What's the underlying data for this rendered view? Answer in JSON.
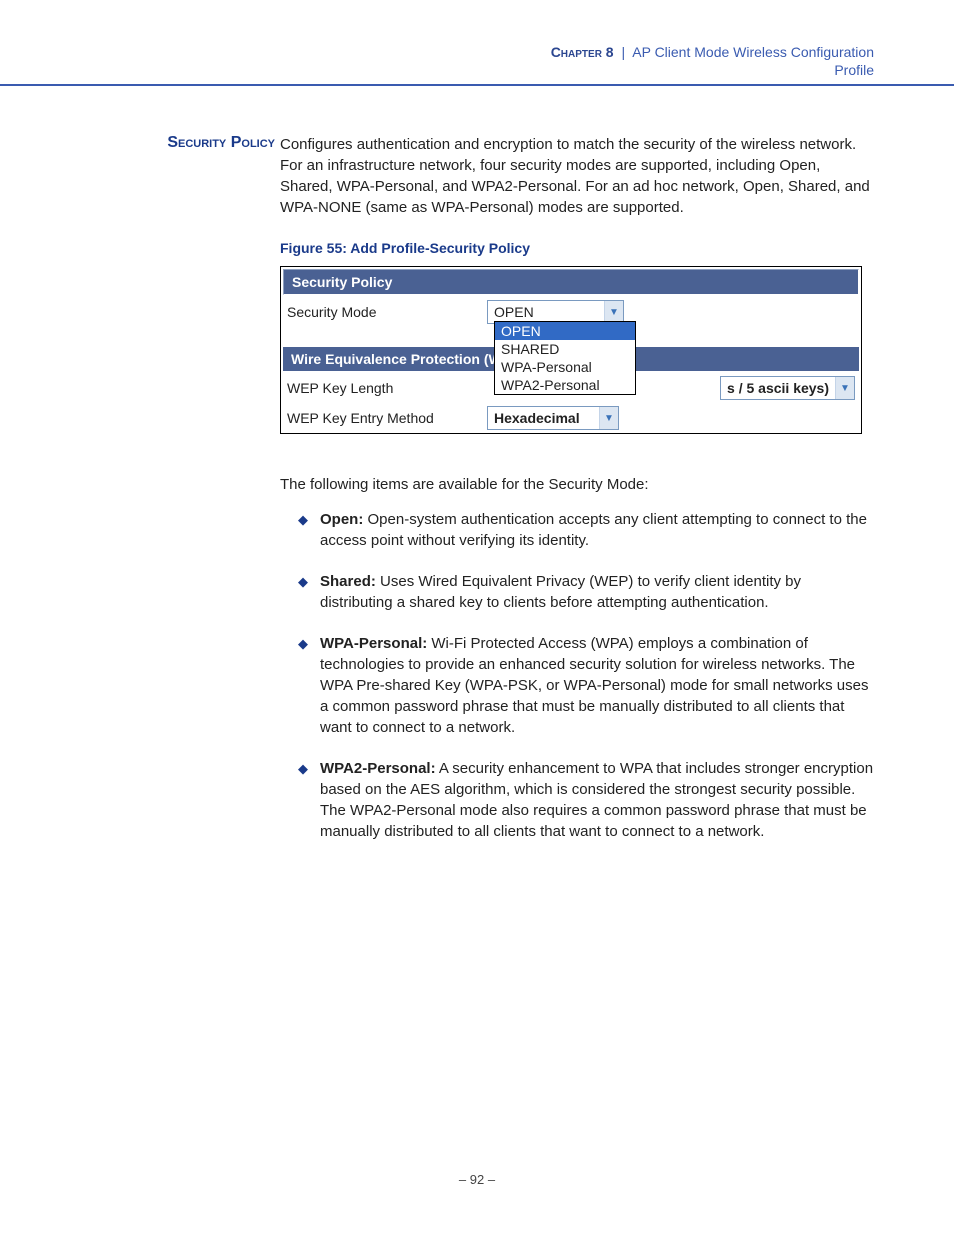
{
  "header": {
    "chapter_label": "Chapter 8",
    "divider": "|",
    "chapter_title": "AP Client Mode Wireless Configuration",
    "subtitle": "Profile"
  },
  "section_heading": "Security Policy",
  "intro_para": "Configures authentication and encryption to match the security of the wireless network. For an infrastructure network, four security modes are supported, including Open, Shared, WPA-Personal, and WPA2-Personal. For an ad hoc network, Open, Shared, and WPA-NONE (same as WPA-Personal) modes are supported.",
  "figure_caption": "Figure 55:  Add Profile-Security Policy",
  "figure": {
    "title": "Security Policy",
    "security_mode_label": "Security Mode",
    "security_mode_value": "OPEN",
    "options": [
      "OPEN",
      "SHARED",
      "WPA-Personal",
      "WPA2-Personal"
    ],
    "wep_section_label": "Wire Equivalence Protection (W",
    "wep_key_length_label": "WEP Key Length",
    "wep_key_length_partial": "s / 5 ascii keys)",
    "wep_entry_label": "WEP Key Entry Method",
    "wep_entry_value": "Hexadecimal"
  },
  "after_intro": "The following items are available for the Security Mode:",
  "items": [
    {
      "term": "Open:",
      "desc": " Open-system authentication accepts any client attempting to connect to the access point without verifying its identity."
    },
    {
      "term": "Shared:",
      "desc": " Uses Wired Equivalent Privacy (WEP) to verify client identity by distributing a shared key to clients before attempting authentication."
    },
    {
      "term": "WPA-Personal:",
      "desc": " Wi-Fi Protected Access (WPA) employs a combination of technologies to provide an enhanced security solution for wireless networks. The WPA Pre-shared Key (WPA-PSK, or WPA-Personal) mode for small networks uses a common password phrase that must be manually distributed to all clients that want to connect to a network."
    },
    {
      "term": "WPA2-Personal:",
      "desc": " A security enhancement to WPA that includes stronger encryption based on the AES algorithm, which is considered the strongest security possible. The WPA2-Personal mode also requires a common password phrase that must be manually distributed to all clients that want to connect to a network."
    }
  ],
  "page_number": "–  92  –"
}
